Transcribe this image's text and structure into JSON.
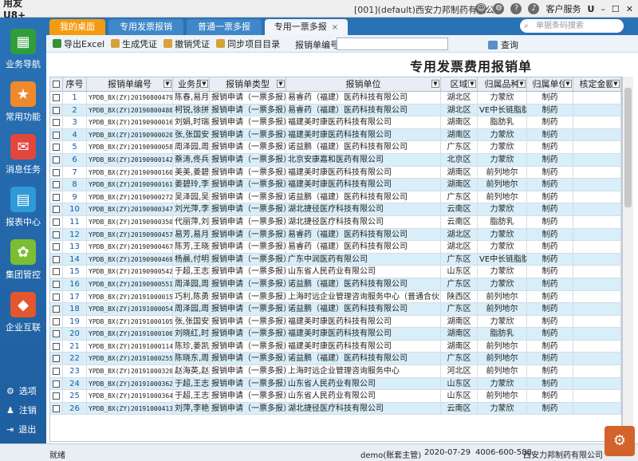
{
  "app": {
    "title": "用友U8+",
    "company_window": "[001](default)西安力邦制药有限公司",
    "service_label": "客户服务",
    "search_placeholder": "单据条码搜索"
  },
  "sidebar": {
    "items": [
      {
        "label": "业务导航",
        "icon": "grid-icon",
        "color": "#2f9e3a"
      },
      {
        "label": "常用功能",
        "icon": "star-icon",
        "color": "#f0892b"
      },
      {
        "label": "消息任务",
        "icon": "message-icon",
        "color": "#e2463d"
      },
      {
        "label": "报表中心",
        "icon": "report-icon",
        "color": "#2f9ad8"
      },
      {
        "label": "集团管控",
        "icon": "group-icon",
        "color": "#7bbd33"
      },
      {
        "label": "企业互联",
        "icon": "link-icon",
        "color": "#e4572e"
      }
    ],
    "bottom": [
      {
        "label": "选项",
        "icon": "gear-icon"
      },
      {
        "label": "注销",
        "icon": "user-icon"
      },
      {
        "label": "退出",
        "icon": "exit-icon"
      }
    ]
  },
  "tabs": [
    {
      "label": "我的桌面"
    },
    {
      "label": "专用发票报销"
    },
    {
      "label": "普通一票多报"
    },
    {
      "label": "专用一票多报"
    }
  ],
  "toolbar": {
    "export": "导出Excel",
    "voucher": "生成凭证",
    "cancel_voucher": "撤销凭证",
    "sync": "同步项目目录",
    "filter_label": "报销单编号",
    "query": "查询"
  },
  "report_title": "专用发票费用报销单",
  "table": {
    "headers": [
      "序号",
      "报销单编号",
      "业务员",
      "报销单类型",
      "报销单位",
      "区域",
      "归属品种",
      "归属单位",
      "核定金额"
    ],
    "rows": [
      [
        "1",
        "YPDB_BX(ZY)20190800479",
        "陈春,易月,郑",
        "报销申请（一票多报）",
        "易睿药（福建）医药科技有限公司",
        "湖北区",
        "力蒙欣",
        "制药"
      ],
      [
        "2",
        "YPDB_BX(ZY)20190800480",
        "柯锐,徐拼",
        "报销申请（一票多报）",
        "易睿药（福建）医药科技有限公司",
        "湖北区",
        "VE中长链脂肪乳",
        "制药"
      ],
      [
        "3",
        "YPDB_BX(ZY)20190900016",
        "刘娟,时瑞",
        "报销申请（一票多报）",
        "福建美时康医药科技有限公司",
        "湖南区",
        "脂肪乳",
        "制药"
      ],
      [
        "4",
        "YPDB_BX(ZY)20190900020",
        "张,张国安,何",
        "报销申请（一票多报）",
        "福建美时康医药科技有限公司",
        "湖南区",
        "力蒙欣",
        "制药"
      ],
      [
        "5",
        "YPDB_BX(ZY)20190900058",
        "周泽园,周泽",
        "报销申请（一票多报）",
        "诺益鹏（福建）医药科技有限公司",
        "广东区",
        "力蒙欣",
        "制药"
      ],
      [
        "6",
        "YPDB_BX(ZY)20190900142",
        "蔡涛,佟兵",
        "报销申请（一票多报）",
        "北京安康嘉和医药有限公司",
        "北京区",
        "力蒙欣",
        "制药"
      ],
      [
        "7",
        "YPDB_BX(ZY)20190900160",
        "美美,姜碧玲",
        "报销申请（一票多报）",
        "福建美时康医药科技有限公司",
        "湖南区",
        "前列地尔",
        "制药"
      ],
      [
        "8",
        "YPDB_BX(ZY)20190900161",
        "姜碧玲,李莉",
        "报销申请（一票多报）",
        "福建美时康医药科技有限公司",
        "湖南区",
        "前列地尔",
        "制药"
      ],
      [
        "9",
        "YPDB_BX(ZY)20190900272",
        "吴泽园,吴俊",
        "报销申请（一票多报）",
        "诺益鹏（福建）医药科技有限公司",
        "广东区",
        "前列地尔",
        "制药"
      ],
      [
        "10",
        "YPDB_BX(ZY)20190900347",
        "刘光萍,李波",
        "报销申请（一票多报）",
        "湖北捷径医疗科技有限公司",
        "云南区",
        "力蒙欣",
        "制药"
      ],
      [
        "11",
        "YPDB_BX(ZY)20190900350",
        "代丽萍,刘孙",
        "报销申请（一票多报）",
        "湖北捷径医疗科技有限公司",
        "云南区",
        "脂肪乳",
        "制药"
      ],
      [
        "12",
        "YPDB_BX(ZY)20190900457",
        "易芳,易月,桃",
        "报销申请（一票多报）",
        "易睿药（福建）医药科技有限公司",
        "湖北区",
        "力蒙欣",
        "制药"
      ],
      [
        "13",
        "YPDB_BX(ZY)20190900467",
        "陈芳,王晓君",
        "报销申请（一票多报）",
        "易睿药（福建）医药科技有限公司",
        "湖北区",
        "力蒙欣",
        "制药"
      ],
      [
        "14",
        "YPDB_BX(ZY)20190900469",
        "杨晨,付明",
        "报销申请（一票多报）",
        "广东中润医药有限公司",
        "广东区",
        "VE中长链脂肪乳",
        "制药"
      ],
      [
        "15",
        "YPDB_BX(ZY)20190900542",
        "于超,王志",
        "报销申请（一票多报）",
        "山东省人民药业有限公司",
        "山东区",
        "力蒙欣",
        "制药"
      ],
      [
        "16",
        "YPDB_BX(ZY)20190900551",
        "周泽园,周泽",
        "报销申请（一票多报）",
        "诺益鹏（福建）医药科技有限公司",
        "广东区",
        "力蒙欣",
        "制药"
      ],
      [
        "17",
        "YPDB_BX(ZY)20191000015",
        "巧利,陈勇",
        "报销申请（一票多报）",
        "上海时远企业管理咨询服务中心（普通合伙）",
        "陕西区",
        "前列地尔",
        "制药"
      ],
      [
        "18",
        "YPDB_BX(ZY)20191000054",
        "周泽园,周泽",
        "报销申请（一票多报）",
        "诺益鹏（福建）医药科技有限公司",
        "广东区",
        "前列地尔",
        "制药"
      ],
      [
        "19",
        "YPDB_BX(ZY)20191000105",
        "张,张国安,何",
        "报销申请（一票多报）",
        "福建美时康医药科技有限公司",
        "湖南区",
        "力蒙欣",
        "制药"
      ],
      [
        "20",
        "YPDB_BX(ZY)20191000106",
        "刘晓红,时瑞",
        "报销申请（一票多报）",
        "福建美时康医药科技有限公司",
        "湖南区",
        "脂肪乳",
        "制药"
      ],
      [
        "21",
        "YPDB_BX(ZY)20191000114",
        "陈珍,姜凯,张",
        "报销申请（一票多报）",
        "福建美时康医药科技有限公司",
        "湖南区",
        "前列地尔",
        "制药"
      ],
      [
        "22",
        "YPDB_BX(ZY)20191000255",
        "陈晓东,周泽",
        "报销申请（一票多报）",
        "诺益鹏（福建）医药科技有限公司",
        "广东区",
        "前列地尔",
        "制药"
      ],
      [
        "23",
        "YPDB_BX(ZY)20191000320",
        "赵海英,赵蓉",
        "报销申请（一票多报）",
        "上海时远企业管理咨询服务中心",
        "河北区",
        "前列地尔",
        "制药"
      ],
      [
        "24",
        "YPDB_BX(ZY)20191000362",
        "于超,王志",
        "报销申请（一票多报）",
        "山东省人民药业有限公司",
        "山东区",
        "力蒙欣",
        "制药"
      ],
      [
        "25",
        "YPDB_BX(ZY)20191000364",
        "于超,王志",
        "报销申请（一票多报）",
        "山东省人民药业有限公司",
        "山东区",
        "前列地尔",
        "制药"
      ],
      [
        "26",
        "YPDB_BX(ZY)20191000413",
        "刘萍,李艳,张",
        "报销申请（一票多报）",
        "湖北捷径医疗科技有限公司",
        "云南区",
        "力蒙欣",
        "制药"
      ]
    ]
  },
  "status": {
    "ready": "就绪",
    "user": "demo(账套主管)",
    "date": "2020-07-29",
    "phone": "4006-600-588",
    "company": "西安力邦制药有限公司"
  }
}
